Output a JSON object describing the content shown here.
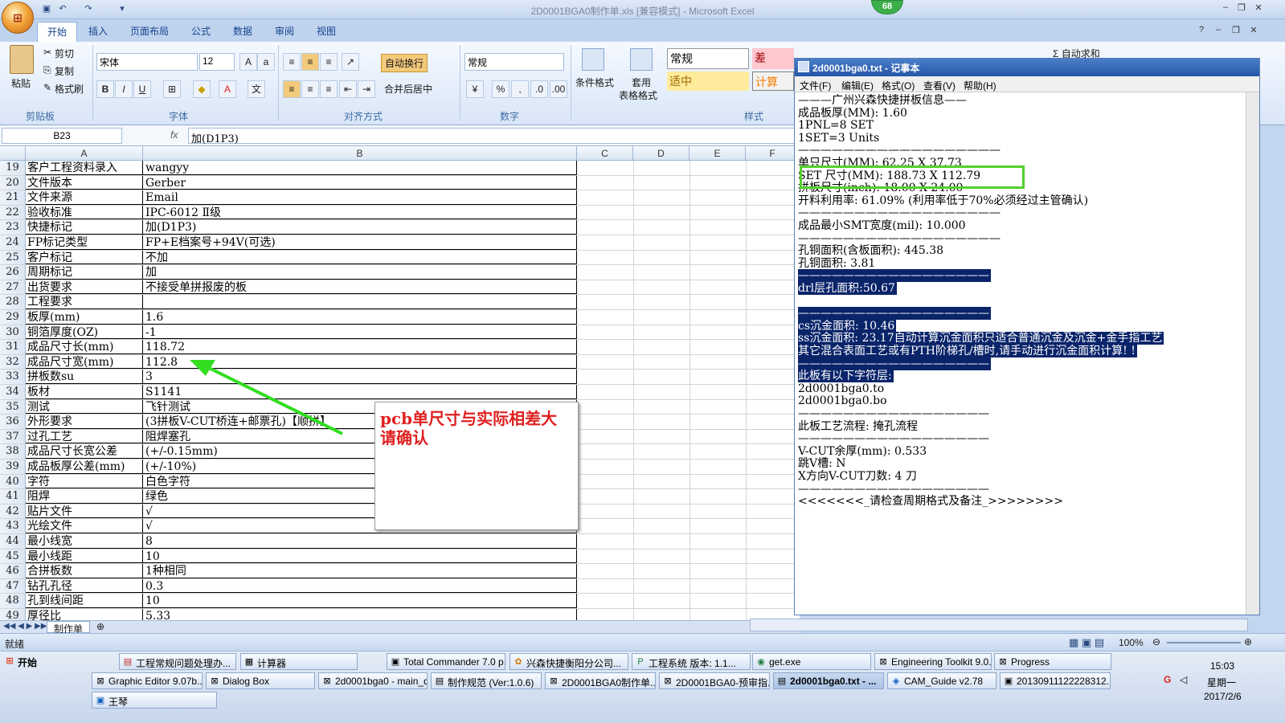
{
  "window": {
    "title": "2D0001BGA0制作单.xls  [兼容模式] - Microsoft Excel",
    "badge": "68"
  },
  "ribbon": {
    "tabs": [
      "开始",
      "插入",
      "页面布局",
      "公式",
      "数据",
      "审阅",
      "视图"
    ],
    "clipboard": {
      "paste": "粘贴",
      "cut": "剪切",
      "copy": "复制",
      "format_painter": "格式刷",
      "label": "剪贴板"
    },
    "font": {
      "name": "宋体",
      "size": "12",
      "label": "字体"
    },
    "alignment": {
      "wrap": "自动换行",
      "merge": "合并后居中",
      "label": "对齐方式"
    },
    "number": {
      "format": "常规",
      "label": "数字"
    },
    "styles": {
      "conditional": "条件格式",
      "apply_table": "套用",
      "table_format": "表格格式",
      "normal": "常规",
      "bad": "差",
      "neutral": "适中",
      "calc": "计算",
      "label": "样式"
    },
    "editing": {
      "autosum": "自动求和"
    }
  },
  "formula_bar": {
    "cell_ref": "B23",
    "formula": "加(D1P3)",
    "fx": "fx"
  },
  "columns": [
    "A",
    "B",
    "C",
    "D",
    "E",
    "F"
  ],
  "rows": [
    {
      "n": "19",
      "a": "客户工程资料录入",
      "b": "wangyy"
    },
    {
      "n": "20",
      "a": "文件版本",
      "b": "Gerber"
    },
    {
      "n": "21",
      "a": "文件来源",
      "b": "Email"
    },
    {
      "n": "22",
      "a": "验收标准",
      "b": "IPC-6012 Ⅱ级"
    },
    {
      "n": "23",
      "a": "快捷标记",
      "b": "加(D1P3)"
    },
    {
      "n": "24",
      "a": "FP标记类型",
      "b": "FP+E档案号+94V(可选)"
    },
    {
      "n": "25",
      "a": "客户标记",
      "b": "不加"
    },
    {
      "n": "26",
      "a": "周期标记",
      "b": "加"
    },
    {
      "n": "27",
      "a": "出货要求",
      "b": "不接受单拼报废的板"
    },
    {
      "n": "28",
      "a": "工程要求",
      "b": ""
    },
    {
      "n": "29",
      "a": "板厚(mm)",
      "b": "1.6"
    },
    {
      "n": "30",
      "a": "铜箔厚度(OZ)",
      "b": "-1"
    },
    {
      "n": "31",
      "a": "成品尺寸长(mm)",
      "b": "118.72"
    },
    {
      "n": "32",
      "a": "成品尺寸宽(mm)",
      "b": "112.8"
    },
    {
      "n": "33",
      "a": "拼板数su",
      "b": "3"
    },
    {
      "n": "34",
      "a": "板材",
      "b": "S1141"
    },
    {
      "n": "35",
      "a": "测试",
      "b": "飞针测试"
    },
    {
      "n": "36",
      "a": "外形要求",
      "b": "(3拼板V-CUT桥连+邮票孔)【顺拼】"
    },
    {
      "n": "37",
      "a": "过孔工艺",
      "b": "阻焊塞孔"
    },
    {
      "n": "38",
      "a": "成品尺寸长宽公差",
      "b": "(+/-0.15mm)"
    },
    {
      "n": "39",
      "a": "成品板厚公差(mm)",
      "b": "(+/-10%)"
    },
    {
      "n": "40",
      "a": "字符",
      "b": "白色字符"
    },
    {
      "n": "41",
      "a": "阻焊",
      "b": "绿色"
    },
    {
      "n": "42",
      "a": "贴片文件",
      "b": "√"
    },
    {
      "n": "43",
      "a": "光绘文件",
      "b": "√"
    },
    {
      "n": "44",
      "a": "最小线宽",
      "b": "8"
    },
    {
      "n": "45",
      "a": "最小线距",
      "b": "10"
    },
    {
      "n": "46",
      "a": "合拼板数",
      "b": "1种相同"
    },
    {
      "n": "47",
      "a": "钻孔孔径",
      "b": "0.3"
    },
    {
      "n": "48",
      "a": "孔到线间距",
      "b": "10"
    },
    {
      "n": "49",
      "a": "厚径比",
      "b": "5.33"
    }
  ],
  "sheet_tab": "制作单",
  "status": {
    "ready": "就绪",
    "zoom": "100%"
  },
  "callout": "pcb单尺寸与实际相差大 请确认",
  "notepad": {
    "title": "2d0001bga0.txt - 记事本",
    "menu": [
      "文件(F)",
      "编辑(E)",
      "格式(O)",
      "查看(V)",
      "帮助(H)"
    ],
    "lines": [
      {
        "t": "———广州兴森快捷拼板信息——",
        "sel": false
      },
      {
        "t": "成品板厚(MM): 1.60",
        "sel": false
      },
      {
        "t": "1PNL=8 SET",
        "sel": false
      },
      {
        "t": "1SET=3 Units",
        "sel": false
      },
      {
        "t": "——————————————————",
        "sel": false
      },
      {
        "t": "单只尺寸(MM): 62.25 X 37.73",
        "sel": false
      },
      {
        "t": "SET 尺寸(MM): 188.73 X 112.79",
        "sel": false
      },
      {
        "t": "拼板尺寸(inch): 18.00 X 24.00",
        "sel": false
      },
      {
        "t": "开料利用率: 61.09% (利用率低于70%必须经过主管确认)",
        "sel": false
      },
      {
        "t": "——————————————————",
        "sel": false
      },
      {
        "t": "成品最小SMT宽度(mil): 10.000",
        "sel": false
      },
      {
        "t": "——————————————————",
        "sel": false
      },
      {
        "t": "孔铜面积(含板面积): 445.38",
        "sel": false
      },
      {
        "t": "孔铜面积: 3.81",
        "sel": false
      },
      {
        "t": "—————————————————",
        "sel": true
      },
      {
        "t": "drl层孔面积:50.67",
        "sel": true
      },
      {
        "t": "",
        "sel": false
      },
      {
        "t": "—————————————————",
        "sel": true
      },
      {
        "t": "cs沉金面积: 10.46",
        "sel": true
      },
      {
        "t": "ss沉金面积: 23.17自动计算沉金面积只适合普通沉金及沉金+金手指工艺",
        "sel": true
      },
      {
        "t": "其它混合表面工艺或有PTH阶梯孔/槽时,请手动进行沉金面积计算! !",
        "sel": true
      },
      {
        "t": "—————————————————",
        "sel": true
      },
      {
        "t": "此板有以下字符层:",
        "sel": true
      },
      {
        "t": "2d0001bga0.to",
        "sel": false
      },
      {
        "t": "2d0001bga0.bo",
        "sel": false
      },
      {
        "t": "—————————————————",
        "sel": false
      },
      {
        "t": "此板工艺流程: 掩孔流程",
        "sel": false
      },
      {
        "t": "—————————————————",
        "sel": false
      },
      {
        "t": "V-CUT余厚(mm): 0.533",
        "sel": false
      },
      {
        "t": "跳V槽: N",
        "sel": false
      },
      {
        "t": "X方向V-CUT刀数: 4 刀",
        "sel": false
      },
      {
        "t": "—————————————————",
        "sel": false
      },
      {
        "t": "<<<<<<<_请检查周期格式及备注_>>>>>>>>",
        "sel": false
      }
    ]
  },
  "taskbar": {
    "start": "开始",
    "row1": [
      "工程常规问题处理办...",
      "计算器",
      "Total Commander 7.0 p...",
      "兴森快捷衡阳分公司...",
      "工程系统  版本: 1.1...",
      "get.exe",
      "Engineering Toolkit 9.0...",
      "Progress"
    ],
    "row2": [
      "Graphic Editor 9.07b...",
      "Dialog Box",
      "2d0001bga0 - main_qa",
      "制作规范 (Ver:1.0.6)",
      "2D0001BGA0制作单...",
      "2D0001BGA0-预审指...",
      "2d0001bga0.txt - ...",
      "CAM_Guide v2.78",
      "20130911122228312..."
    ],
    "row3": [
      "王琴"
    ],
    "time": "15:03",
    "weekday": "星期一",
    "date": "2017/2/6"
  },
  "colors": {
    "highlight_box": "#52d12e",
    "callout_text": "#e02020",
    "arrow": "#33dd22",
    "selection": "#0a246a"
  }
}
